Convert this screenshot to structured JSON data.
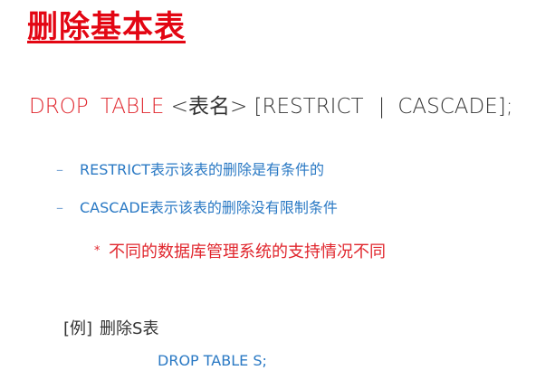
{
  "slide": {
    "title": "删除基本表",
    "syntax": {
      "keyword": "DROP TABLE",
      "table_name": " <表名> [RESTRICT",
      "separator": "|",
      "tail": "CASCADE];"
    },
    "bullets": [
      "RESTRICT表示该表的删除是有条件的",
      "CASCADE表示该表的删除没有限制条件"
    ],
    "bullet_marker": "–",
    "note": {
      "marker": "*",
      "text": "不同的数据库管理系统的支持情况不同"
    },
    "example": {
      "tag": "[例]",
      "text": "删除S表",
      "statement": "DROP TABLE S;"
    },
    "colors": {
      "title": "#e30613",
      "keyword": "#e0262d",
      "bullet": "#2a79c4",
      "body": "#333333"
    }
  }
}
